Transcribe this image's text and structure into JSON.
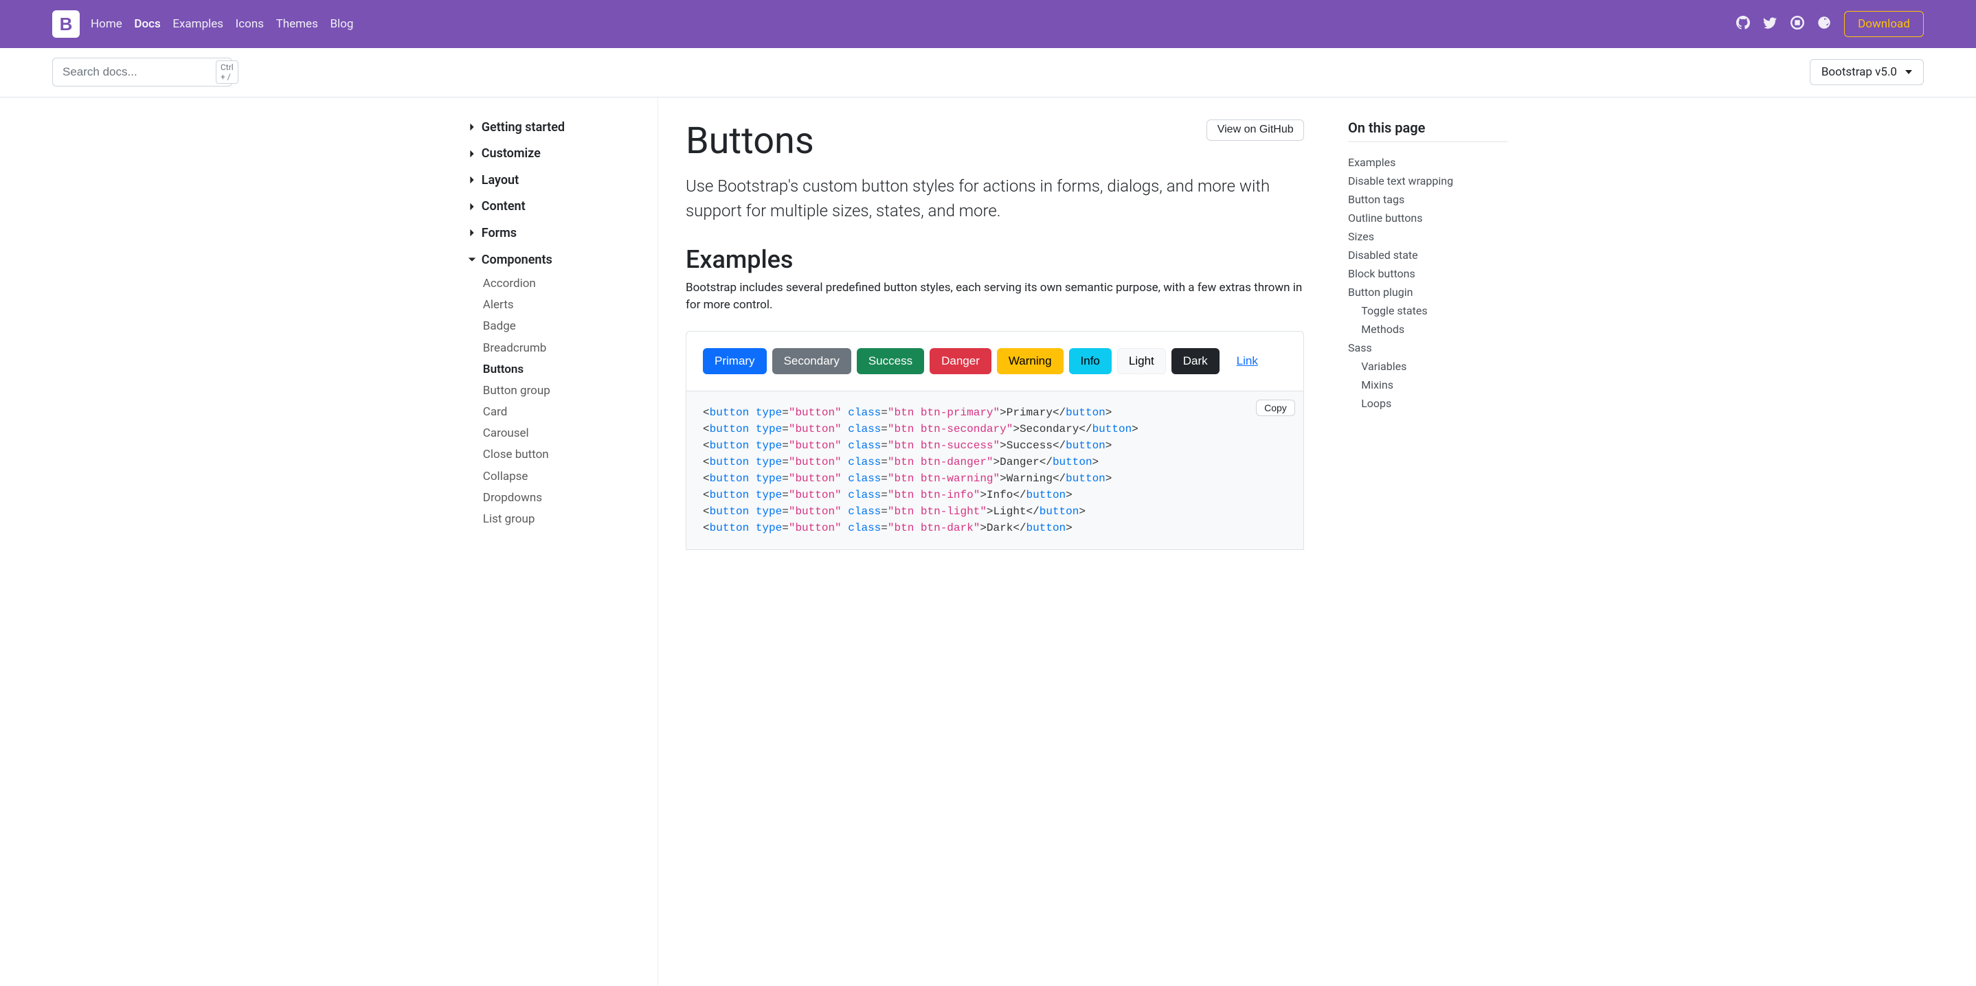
{
  "navbar": {
    "logo_letter": "B",
    "links": [
      {
        "label": "Home",
        "active": false
      },
      {
        "label": "Docs",
        "active": true
      },
      {
        "label": "Examples",
        "active": false
      },
      {
        "label": "Icons",
        "active": false
      },
      {
        "label": "Themes",
        "active": false
      },
      {
        "label": "Blog",
        "active": false
      }
    ],
    "icons": [
      "github-icon",
      "twitter-icon",
      "slack-icon",
      "opencollective-icon"
    ],
    "download_label": "Download"
  },
  "subheader": {
    "search_placeholder": "Search docs...",
    "shortcut": "Ctrl + /",
    "version_label": "Bootstrap v5.0"
  },
  "sidebar": {
    "sections": [
      {
        "label": "Getting started",
        "expanded": false
      },
      {
        "label": "Customize",
        "expanded": false
      },
      {
        "label": "Layout",
        "expanded": false
      },
      {
        "label": "Content",
        "expanded": false
      },
      {
        "label": "Forms",
        "expanded": false
      },
      {
        "label": "Components",
        "expanded": true
      }
    ],
    "components": [
      {
        "label": "Accordion",
        "active": false
      },
      {
        "label": "Alerts",
        "active": false
      },
      {
        "label": "Badge",
        "active": false
      },
      {
        "label": "Breadcrumb",
        "active": false
      },
      {
        "label": "Buttons",
        "active": true
      },
      {
        "label": "Button group",
        "active": false
      },
      {
        "label": "Card",
        "active": false
      },
      {
        "label": "Carousel",
        "active": false
      },
      {
        "label": "Close button",
        "active": false
      },
      {
        "label": "Collapse",
        "active": false
      },
      {
        "label": "Dropdowns",
        "active": false
      },
      {
        "label": "List group",
        "active": false
      }
    ]
  },
  "main": {
    "title": "Buttons",
    "view_github": "View on GitHub",
    "lead": "Use Bootstrap's custom button styles for actions in forms, dialogs, and more with support for multiple sizes, states, and more.",
    "examples_heading": "Examples",
    "examples_para": "Bootstrap includes several predefined button styles, each serving its own semantic purpose, with a few extras thrown in for more control.",
    "buttons": [
      {
        "label": "Primary",
        "cls": "btn-primary"
      },
      {
        "label": "Secondary",
        "cls": "btn-secondary"
      },
      {
        "label": "Success",
        "cls": "btn-success"
      },
      {
        "label": "Danger",
        "cls": "btn-danger"
      },
      {
        "label": "Warning",
        "cls": "btn-warning"
      },
      {
        "label": "Info",
        "cls": "btn-info"
      },
      {
        "label": "Light",
        "cls": "btn-light"
      },
      {
        "label": "Dark",
        "cls": "btn-dark"
      },
      {
        "label": "Link",
        "cls": "btn-link"
      }
    ],
    "copy_label": "Copy",
    "code_lines": [
      {
        "cls": "btn btn-primary",
        "text": "Primary"
      },
      {
        "cls": "btn btn-secondary",
        "text": "Secondary"
      },
      {
        "cls": "btn btn-success",
        "text": "Success"
      },
      {
        "cls": "btn btn-danger",
        "text": "Danger"
      },
      {
        "cls": "btn btn-warning",
        "text": "Warning"
      },
      {
        "cls": "btn btn-info",
        "text": "Info"
      },
      {
        "cls": "btn btn-light",
        "text": "Light"
      },
      {
        "cls": "btn btn-dark",
        "text": "Dark"
      }
    ]
  },
  "toc": {
    "heading": "On this page",
    "items": [
      {
        "label": "Examples",
        "indent": false
      },
      {
        "label": "Disable text wrapping",
        "indent": false
      },
      {
        "label": "Button tags",
        "indent": false
      },
      {
        "label": "Outline buttons",
        "indent": false
      },
      {
        "label": "Sizes",
        "indent": false
      },
      {
        "label": "Disabled state",
        "indent": false
      },
      {
        "label": "Block buttons",
        "indent": false
      },
      {
        "label": "Button plugin",
        "indent": false
      },
      {
        "label": "Toggle states",
        "indent": true
      },
      {
        "label": "Methods",
        "indent": true
      },
      {
        "label": "Sass",
        "indent": false
      },
      {
        "label": "Variables",
        "indent": true
      },
      {
        "label": "Mixins",
        "indent": true
      },
      {
        "label": "Loops",
        "indent": true
      }
    ]
  }
}
